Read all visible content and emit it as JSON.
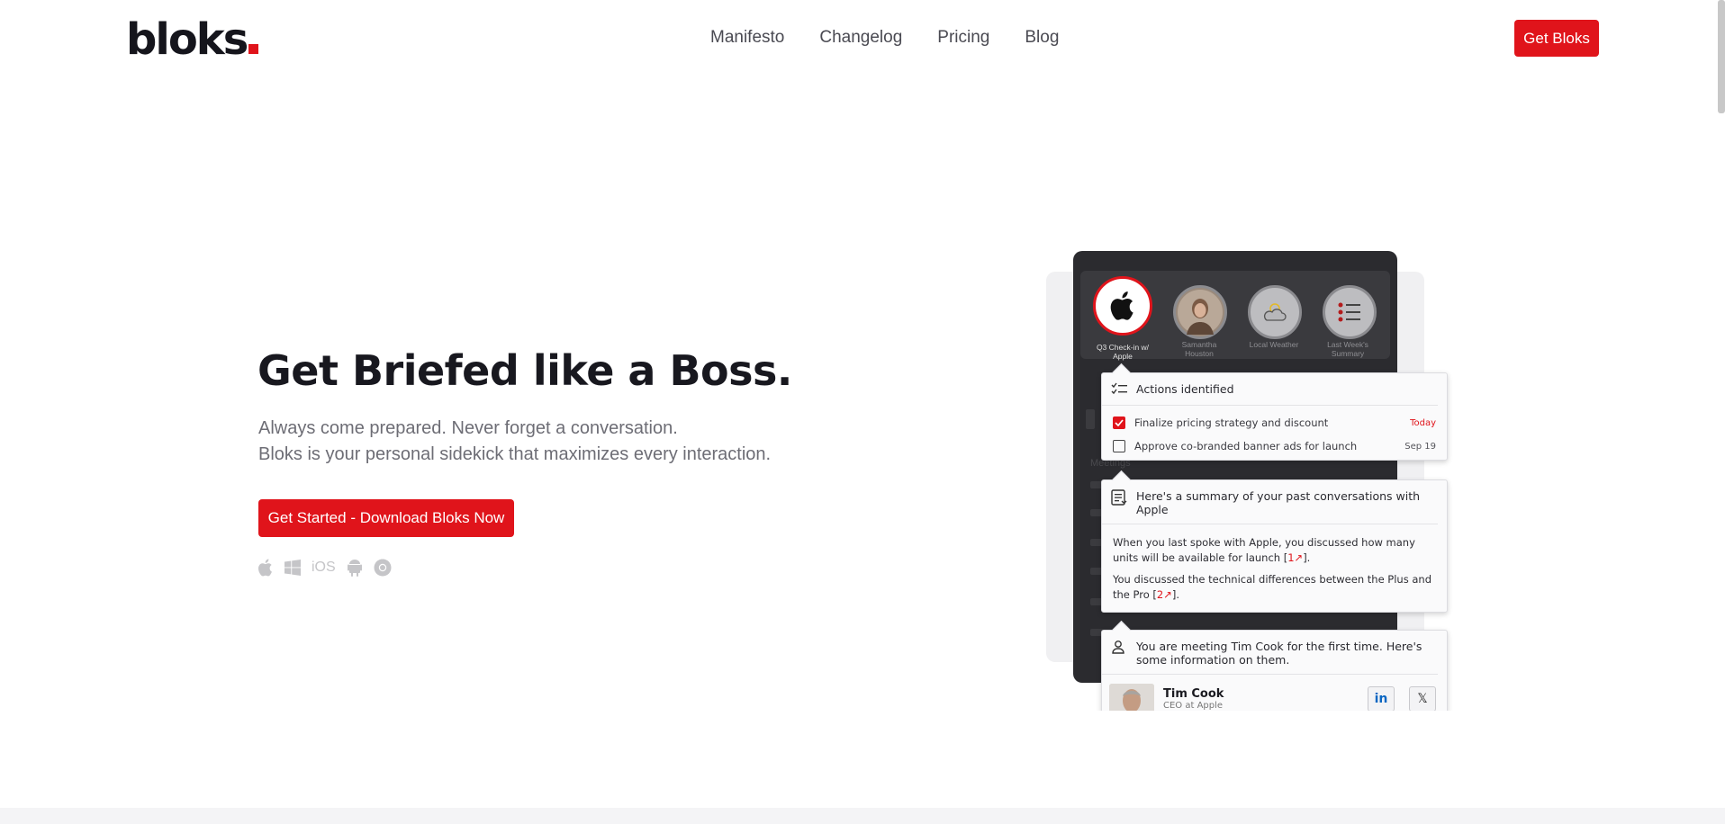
{
  "header": {
    "logo": "bloks",
    "nav": [
      "Manifesto",
      "Changelog",
      "Pricing",
      "Blog"
    ],
    "cta": "Get Bloks"
  },
  "hero": {
    "title": "Get Briefed like a Boss.",
    "subtitle_line1": "Always come prepared. Never forget a conversation.",
    "subtitle_line2": "Bloks is your personal sidekick that maximizes every interaction.",
    "cta": "Get Started - Download Bloks Now",
    "platforms": [
      "apple-icon",
      "windows-icon",
      "iOS",
      "android-icon",
      "chrome-icon"
    ],
    "ios_label": "iOS"
  },
  "mockup": {
    "avatars": [
      {
        "label": "Q3 Check-in w/ Apple",
        "icon": "apple-icon",
        "active": true
      },
      {
        "label": "Samantha Houston",
        "icon": "person-photo"
      },
      {
        "label": "Local Weather",
        "icon": "weather-icon"
      },
      {
        "label": "Last Week's Summary",
        "icon": "list-icon"
      }
    ],
    "ghost_heading": "Meetings",
    "actions_card": {
      "title": "Actions identified",
      "items": [
        {
          "text": "Finalize pricing strategy and discount",
          "due": "Today",
          "checked": true
        },
        {
          "text": "Approve co-branded banner ads for launch",
          "due": "Sep 19",
          "checked": false
        }
      ]
    },
    "summary_card": {
      "title": "Here's a summary of your past conversations with Apple",
      "p1_pre": "When you last spoke with Apple, you discussed how many units will be available for launch [",
      "p1_ref": "1",
      "p1_post": "].",
      "p2_pre": "You discussed the technical differences between the Plus and the Pro [",
      "p2_ref": "2",
      "p2_post": "]."
    },
    "person_card": {
      "title": "You are meeting Tim Cook for the first time. Here's some information on them.",
      "name": "Tim Cook",
      "role": "CEO at Apple"
    }
  },
  "colors": {
    "accent": "#e0141b",
    "phone": "#2b2b2f",
    "text": "#18181f",
    "muted": "#6d6d75"
  }
}
